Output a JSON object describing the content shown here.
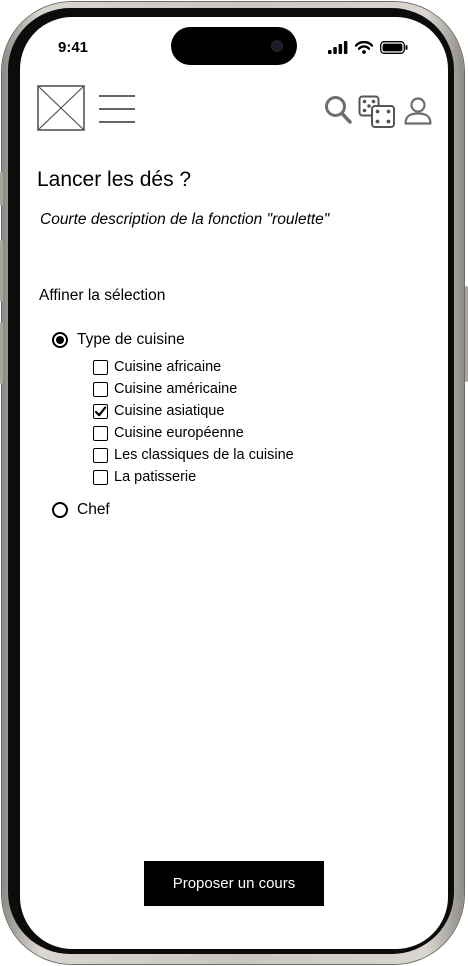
{
  "status_bar": {
    "time": "9:41"
  },
  "header": {
    "logo_icon": "image-placeholder-icon",
    "menu_icon": "hamburger-menu-icon",
    "search_icon": "search-icon",
    "dice_icon": "dice-icon",
    "profile_icon": "user-icon"
  },
  "page": {
    "title": "Lancer les dés ?",
    "description": "Courte description de la fonction \"roulette\"",
    "refine_label": "Affiner la sélection"
  },
  "filters": {
    "options": [
      {
        "label": "Type de cuisine",
        "selected": true
      },
      {
        "label": "Chef",
        "selected": false
      }
    ],
    "cuisine_types": [
      {
        "label": "Cuisine africaine",
        "checked": false
      },
      {
        "label": "Cuisine américaine",
        "checked": false
      },
      {
        "label": "Cuisine asiatique",
        "checked": true
      },
      {
        "label": "Cuisine européenne",
        "checked": false
      },
      {
        "label": "Les classiques de la cuisine",
        "checked": false
      },
      {
        "label": "La patisserie",
        "checked": false
      }
    ]
  },
  "actions": {
    "primary_label": "Proposer un cours"
  },
  "colors": {
    "text": "#000000",
    "button_bg": "#000000",
    "button_text": "#ffffff",
    "background": "#ffffff"
  }
}
